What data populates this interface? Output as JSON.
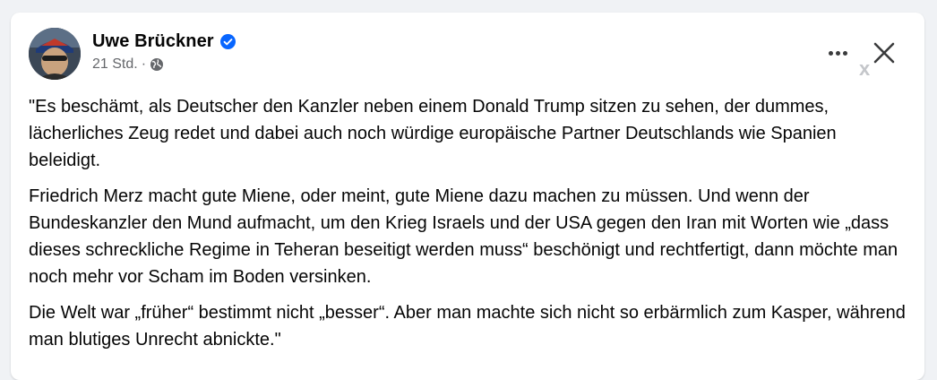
{
  "post": {
    "author": "Uwe Brückner",
    "verified_icon": "verified-badge-icon",
    "timestamp": "21 Std.",
    "separator": "·",
    "audience_icon": "globe-icon",
    "paragraphs": [
      "\"Es beschämt, als Deutscher den Kanzler neben einem Donald Trump sitzen zu sehen, der dummes, lächerliches Zeug redet und dabei auch noch würdige europäische Partner Deutschlands wie Spanien  beleidigt.",
      "Friedrich Merz macht gute Miene, oder meint, gute Miene dazu machen zu müssen. Und wenn der Bundeskanzler den Mund aufmacht, um den Krieg Israels und der USA gegen den Iran mit Worten wie „dass dieses schreckliche Regime in Teheran beseitigt werden muss“ beschönigt und rechtfertigt, dann möchte man noch mehr vor Scham im Boden versinken.",
      "Die Welt war „früher“ bestimmt nicht „besser“. Aber man machte sich nicht so erbärmlich zum Kasper, während man blutiges Unrecht abnickte.\""
    ]
  },
  "controls": {
    "more_icon": "more-horizontal-icon",
    "close_icon": "close-icon",
    "overlay_x": "x"
  },
  "colors": {
    "page_bg": "#f0f2f5",
    "card_bg": "#ffffff",
    "verified_blue": "#0866ff",
    "secondary_text": "#65676b"
  }
}
